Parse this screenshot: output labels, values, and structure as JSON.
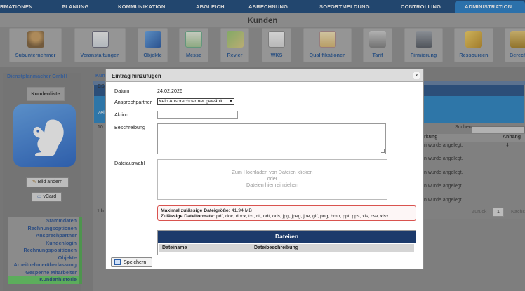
{
  "topnav": {
    "items": [
      "RMATIONEN",
      "PLANUNG",
      "KOMMUNIKATION",
      "ABGLEICH",
      "ABRECHNUNG",
      "SOFORTMELDUNG",
      "CONTROLLING",
      "ADMINISTRATION"
    ],
    "active": "ADMINISTRATION"
  },
  "page": {
    "title": "Kunden"
  },
  "toolbar": {
    "items": [
      "Subunternehmer",
      "Veranstaltungen",
      "Objekte",
      "Messe",
      "Revier",
      "WKS",
      "Qualifikationen",
      "Tarif",
      "Firmierung",
      "Ressourcen",
      "Berech"
    ]
  },
  "left": {
    "company": "Dienstplanmacher GmbH",
    "kundenliste": "Kundenliste",
    "bild_aendern": "Bild ändern",
    "vcard": "vCard",
    "menu": [
      "Stammdaten",
      "Rechnungsoptionen",
      "Ansprechpartner",
      "Kundenlogin",
      "Rechnungspositionen",
      "Objekte",
      "Arbeitnehmerüberlassung",
      "Gesperrte Mitarbeiter",
      "Kundenhistorie"
    ],
    "active_menu": "Kundenhistorie"
  },
  "background": {
    "kun": "Kun",
    "cs": "CS",
    "zei": "Zei",
    "ten": "10",
    "suchen": "Suchen",
    "col_bemerkung": "rkung",
    "col_anhang": "Anhang",
    "rows": [
      "n wurde angelegt.",
      "n wurde angelegt.",
      "n wurde angelegt.",
      "n wurde angelegt.",
      "n wurde angelegt."
    ],
    "one_b": "1 b",
    "zurueck": "Zurück",
    "page_num": "1",
    "naechste": "Nächs"
  },
  "modal": {
    "title": "Eintrag hinzufügen",
    "close": "×",
    "datum_label": "Datum",
    "datum_value": "24.02.2026",
    "ansprechpartner_label": "Ansprechpartner",
    "ansprechpartner_value": "Kein Ansprechpartner gewählt",
    "aktion_label": "Aktion",
    "aktion_value": "",
    "beschreibung_label": "Beschreibung",
    "dateiauswahl_label": "Dateiauswahl",
    "drop_line1": "Zum Hochladen von Dateien klicken",
    "drop_line2": "oder",
    "drop_line3": "Dateien hier reinziehen",
    "max_label": "Maximal zulässige Dateigröße:",
    "max_value": "41,94 MB",
    "formats_label": "Zulässige Dateiformate:",
    "formats_value": "pdf, doc, docx, txt, rtf, odt, ods, jpg, jpeg, jpe, gif, png, bmp, ppt, pps, xls, csv, xlsx",
    "files_header": "Datei/en",
    "col_name": "Dateiname",
    "col_desc": "Dateibeschreibung",
    "save": "Speichern"
  },
  "colors": {
    "nav": "#0f3f75",
    "nav_active": "#1d78c6",
    "files_header": "#1c3a6b",
    "active_menu": "#5cc85c"
  }
}
